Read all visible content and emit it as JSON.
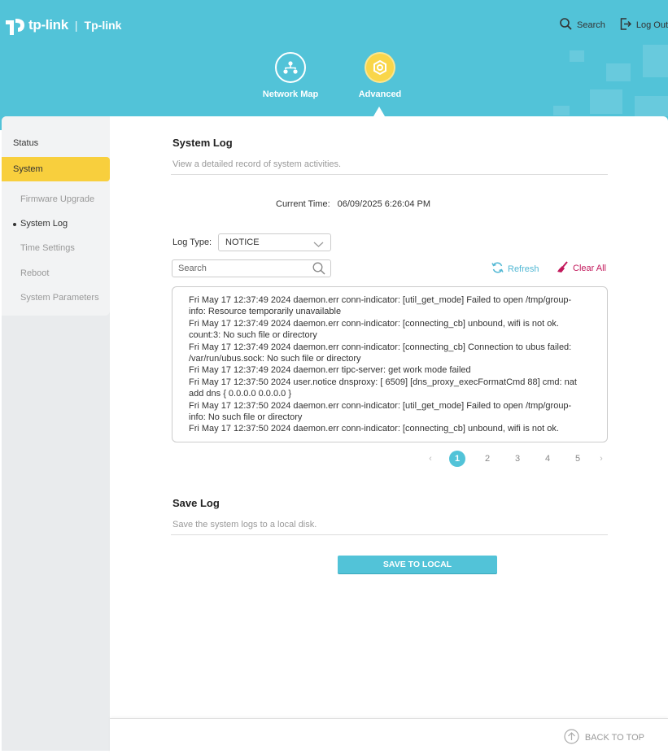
{
  "header": {
    "brand": "tp-link",
    "product": "Tp-link",
    "search_label": "Search",
    "logout_label": "Log Out"
  },
  "nav": {
    "network_map": "Network Map",
    "advanced": "Advanced"
  },
  "sidebar": {
    "status": "Status",
    "system": "System",
    "items": [
      {
        "label": "Firmware Upgrade",
        "active": false
      },
      {
        "label": "System Log",
        "active": true
      },
      {
        "label": "Time Settings",
        "active": false
      },
      {
        "label": "Reboot",
        "active": false
      },
      {
        "label": "System Parameters",
        "active": false
      }
    ]
  },
  "system_log": {
    "title": "System Log",
    "description": "View a detailed record of system activities.",
    "current_time_label": "Current Time:",
    "current_time_value": "06/09/2025 6:26:04 PM",
    "log_type_label": "Log Type:",
    "log_type_value": "NOTICE",
    "search_placeholder": "Search",
    "refresh_label": "Refresh",
    "clear_all_label": "Clear All",
    "lines": [
      "Fri May 17 12:37:49 2024 daemon.err conn-indicator: [util_get_mode] Failed to open /tmp/group-",
      "info: Resource temporarily unavailable",
      "Fri May 17 12:37:49 2024 daemon.err conn-indicator: [connecting_cb] unbound, wifi is not ok.",
      "count:3: No such file or directory",
      "Fri May 17 12:37:49 2024 daemon.err conn-indicator: [connecting_cb] Connection to ubus failed:",
      "/var/run/ubus.sock: No such file or directory",
      "Fri May 17 12:37:49 2024 daemon.err tipc-server: get work mode failed",
      "Fri May 17 12:37:50 2024 user.notice dnsproxy: [ 6509] [dns_proxy_execFormatCmd 88] cmd: nat",
      "add dns { 0.0.0.0 0.0.0.0 }",
      "Fri May 17 12:37:50 2024 daemon.err conn-indicator: [util_get_mode] Failed to open /tmp/group-",
      "info: No such file or directory",
      "Fri May 17 12:37:50 2024 daemon.err conn-indicator: [connecting_cb] unbound, wifi is not ok."
    ],
    "pages": [
      "1",
      "2",
      "3",
      "4",
      "5"
    ],
    "current_page": "1"
  },
  "save_log": {
    "title": "Save Log",
    "description": "Save the system logs to a local disk.",
    "button_label": "SAVE TO LOCAL"
  },
  "footer": {
    "back_to_top": "BACK TO TOP"
  },
  "colors": {
    "header_bg": "#52c3d8",
    "accent_yellow": "#f8cf3d",
    "clear_all": "#c2185b"
  }
}
